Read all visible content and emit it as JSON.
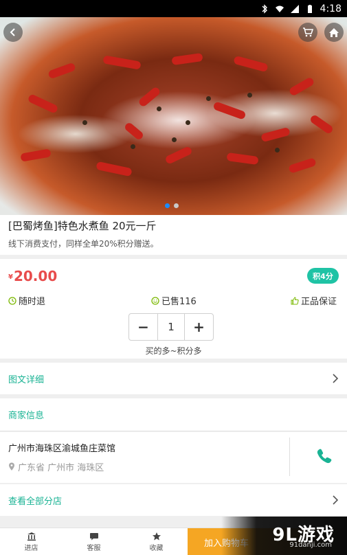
{
  "status_bar": {
    "time": "4:18"
  },
  "product": {
    "title": "[巴蜀烤鱼]特色水煮鱼 20元一斤",
    "subtitle": "线下消费支付，同样全单20%积分赠送。",
    "currency": "¥",
    "price": "20.00",
    "points_badge": "积4分",
    "gallery": {
      "total": 2,
      "active": 1
    }
  },
  "features": {
    "refund": "随时退",
    "sold": "已售116",
    "genuine": "正品保证"
  },
  "quantity": {
    "minus": "−",
    "value": "1",
    "plus": "+",
    "hint": "买的多~积分多"
  },
  "links": {
    "detail": "图文详细",
    "merchant_info": "商家信息",
    "all_branches": "查看全部分店"
  },
  "merchant": {
    "name": "广州市海珠区渝城鱼庄菜馆",
    "address": "广东省 广州市 海珠区"
  },
  "bottom_bar": {
    "tabs": [
      {
        "label": "进店",
        "icon": "bank-icon"
      },
      {
        "label": "客服",
        "icon": "chat-icon"
      },
      {
        "label": "收藏",
        "icon": "star-icon"
      }
    ],
    "add_to_cart": "加入购物车"
  },
  "watermark": {
    "logo": "9L游戏",
    "url": "91danji.com"
  },
  "colors": {
    "accent": "#1ab394",
    "price": "#e84c4c",
    "badge": "#1fc3a5",
    "cart_button": "#f5a623",
    "icon_green": "#7ab800"
  }
}
